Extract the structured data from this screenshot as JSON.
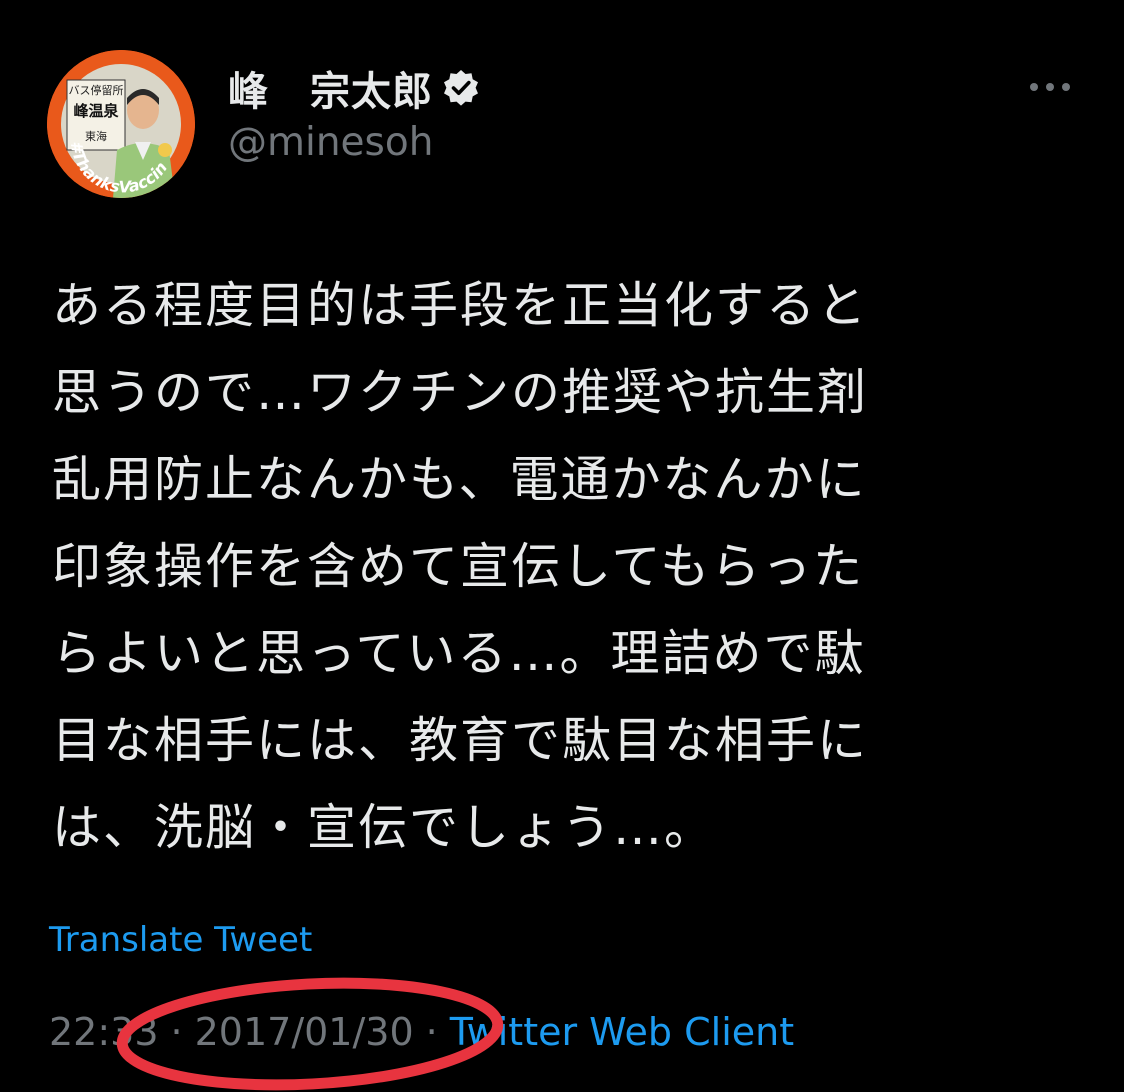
{
  "author": {
    "display_name": "峰　宗太郎",
    "handle": "@minesoh",
    "verified_icon": "verified-badge-icon",
    "avatar": {
      "sign_top": "バス停留所",
      "sign_name": "峰温泉",
      "sign_bottom": "東海",
      "badge_text": "#ThanksVaccine",
      "colors": {
        "ring": "#e9591b",
        "sign": "#f4f1e6"
      }
    }
  },
  "menu": {
    "more_icon": "more-horizontal-icon"
  },
  "tweet": {
    "lines": [
      "ある程度目的は手段を正当化すると",
      "思うので…ワクチンの推奨や抗生剤",
      "乱用防止なんかも、電通かなんかに",
      "印象操作を含めて宣伝してもらった",
      "らよいと思っている…。理詰めで駄",
      "目な相手には、教育で駄目な相手に",
      "は、洗脳・宣伝でしょう…。"
    ]
  },
  "translate_label": "Translate Tweet",
  "meta": {
    "time": "22:33",
    "separator": "·",
    "date": "2017/01/30",
    "client": "Twitter Web Client"
  },
  "colors": {
    "background": "#000000",
    "text": "#e7e9ea",
    "muted": "#71767b",
    "link": "#1d9bf0",
    "annotation": "#e8343f"
  }
}
